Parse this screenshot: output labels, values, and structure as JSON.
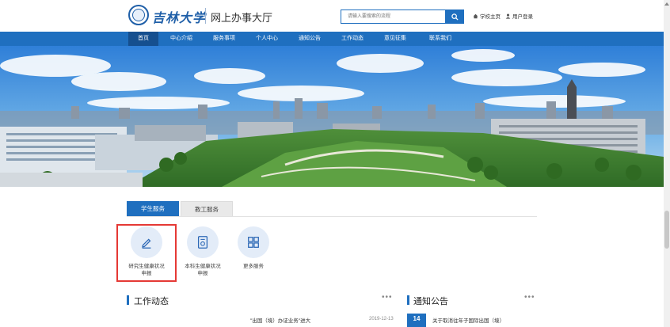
{
  "header": {
    "logo_text": "吉林大学",
    "site_title": "网上办事大厅",
    "search_placeholder": "请输入要搜索的流程",
    "links": [
      {
        "icon": "home-icon",
        "label": "学校主页"
      },
      {
        "icon": "user-icon",
        "label": "用户登录"
      }
    ]
  },
  "nav": {
    "items": [
      "首页",
      "中心介绍",
      "服务事项",
      "个人中心",
      "通知公告",
      "工作动态",
      "意见征集",
      "联系我们"
    ],
    "active": "首页"
  },
  "tabs": [
    "学生服务",
    "教工服务"
  ],
  "active_tab": "学生服务",
  "services": [
    {
      "icon": "pencil-icon",
      "label_line1": "研究生健康状况",
      "label_line2": "申报"
    },
    {
      "icon": "document-icon",
      "label_line1": "本科生健康状况",
      "label_line2": "申报"
    },
    {
      "icon": "grid-icon",
      "label_line1": "更多服务",
      "label_line2": ""
    }
  ],
  "sections": {
    "work_news": {
      "title": "工作动态",
      "more": "•••",
      "items": [
        {
          "title": "\"出国（境）办证业务\"进大",
          "date": "2019-12-13"
        }
      ]
    },
    "notices": {
      "title": "通知公告",
      "more": "•••",
      "items": [
        {
          "day": "14",
          "title": "关于取消往年子国际出国（境）"
        }
      ]
    }
  },
  "colors": {
    "brand_blue": "#1f6fbf",
    "nav_active": "#154f8f",
    "highlight_red": "#e53935"
  }
}
